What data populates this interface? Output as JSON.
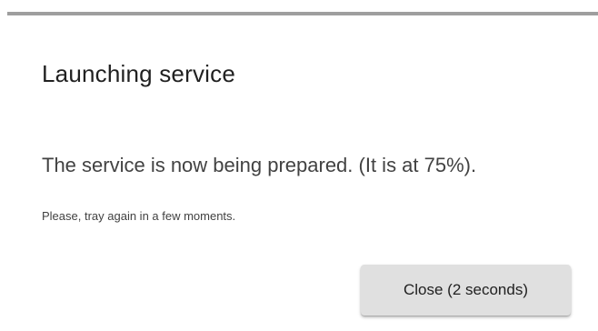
{
  "dialog": {
    "title": "Launching service",
    "message": "The service is now being prepared. (It is at 75%).",
    "hint": "Please, tray again in a few moments.",
    "close_label": "Close (2 seconds)"
  },
  "colors": {
    "top_rule": "#9e9e9e",
    "button_bg": "#e0e0e0",
    "title_text": "#212121",
    "body_text": "#424242"
  }
}
